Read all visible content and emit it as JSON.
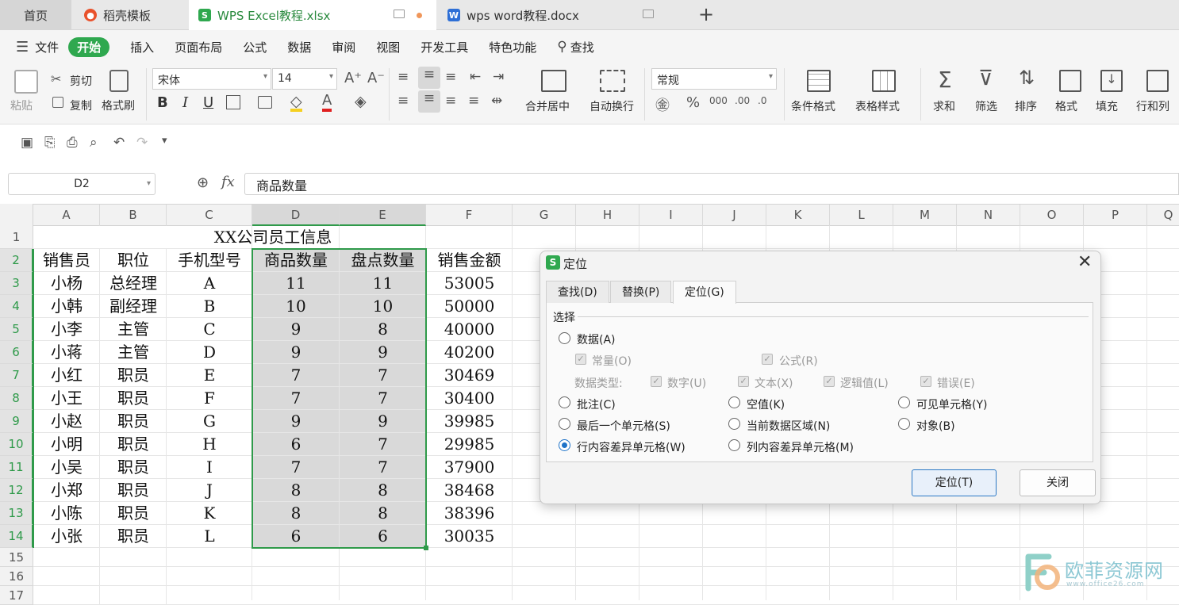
{
  "tabs": {
    "home": "首页",
    "t1": "稻壳模板",
    "t2": "WPS Excel教程.xlsx",
    "t3": "wps word教程.docx",
    "plus": "+"
  },
  "menu": {
    "file": "文件",
    "items": [
      "开始",
      "插入",
      "页面布局",
      "公式",
      "数据",
      "审阅",
      "视图",
      "开发工具",
      "特色功能"
    ],
    "search": "查找"
  },
  "ribbon": {
    "paste": "粘贴",
    "cut": "剪切",
    "copy": "复制",
    "format_painter": "格式刷",
    "font": "宋体",
    "size": "14",
    "bold": "B",
    "italic": "I",
    "underline": "U",
    "merge": "合并居中",
    "wrap": "自动换行",
    "numfmt": "常规",
    "cond_format": "条件格式",
    "table_style": "表格样式",
    "sum": "求和",
    "filter": "筛选",
    "sort": "排序",
    "format": "格式",
    "fill": "填充",
    "rowcol": "行和列"
  },
  "formula": {
    "cell": "D2",
    "fx": "fx",
    "content": "商品数量"
  },
  "columns": [
    "A",
    "B",
    "C",
    "D",
    "E",
    "F",
    "G",
    "H",
    "I",
    "J",
    "K",
    "L",
    "M",
    "N",
    "O",
    "P",
    "Q"
  ],
  "rows": [
    "1",
    "2",
    "3",
    "4",
    "5",
    "6",
    "7",
    "8",
    "9",
    "10",
    "11",
    "12",
    "13",
    "14",
    "15",
    "16",
    "17"
  ],
  "sheet": {
    "title": "XX公司员工信息",
    "headers": [
      "销售员",
      "职位",
      "手机型号",
      "商品数量",
      "盘点数量",
      "销售金额"
    ],
    "data": [
      [
        "小杨",
        "总经理",
        "A",
        "11",
        "11",
        "53005"
      ],
      [
        "小韩",
        "副经理",
        "B",
        "10",
        "10",
        "50000"
      ],
      [
        "小李",
        "主管",
        "C",
        "9",
        "8",
        "40000"
      ],
      [
        "小蒋",
        "主管",
        "D",
        "9",
        "9",
        "40200"
      ],
      [
        "小红",
        "职员",
        "E",
        "7",
        "7",
        "30469"
      ],
      [
        "小王",
        "职员",
        "F",
        "7",
        "7",
        "30400"
      ],
      [
        "小赵",
        "职员",
        "G",
        "9",
        "9",
        "39985"
      ],
      [
        "小明",
        "职员",
        "H",
        "6",
        "7",
        "29985"
      ],
      [
        "小吴",
        "职员",
        "I",
        "7",
        "7",
        "37900"
      ],
      [
        "小郑",
        "职员",
        "J",
        "8",
        "8",
        "38468"
      ],
      [
        "小陈",
        "职员",
        "K",
        "8",
        "8",
        "38396"
      ],
      [
        "小张",
        "职员",
        "L",
        "6",
        "6",
        "30035"
      ]
    ]
  },
  "dialog": {
    "title": "定位",
    "tabs": [
      "查找(D)",
      "替换(P)",
      "定位(G)"
    ],
    "group": "选择",
    "opt_data": "数据(A)",
    "chk_const": "常量(O)",
    "chk_formula": "公式(R)",
    "datatype_label": "数据类型:",
    "chk_number": "数字(U)",
    "chk_text": "文本(X)",
    "chk_logic": "逻辑值(L)",
    "chk_error": "错误(E)",
    "opt_comment": "批注(C)",
    "opt_blank": "空值(K)",
    "opt_visible": "可见单元格(Y)",
    "opt_last": "最后一个单元格(S)",
    "opt_region": "当前数据区域(N)",
    "opt_object": "对象(B)",
    "opt_rowdiff": "行内容差异单元格(W)",
    "opt_coldiff": "列内容差异单元格(M)",
    "btn_locate": "定位(T)",
    "btn_close": "关闭"
  },
  "watermark": {
    "text": "欧菲资源网",
    "url": "www.office26.com"
  }
}
